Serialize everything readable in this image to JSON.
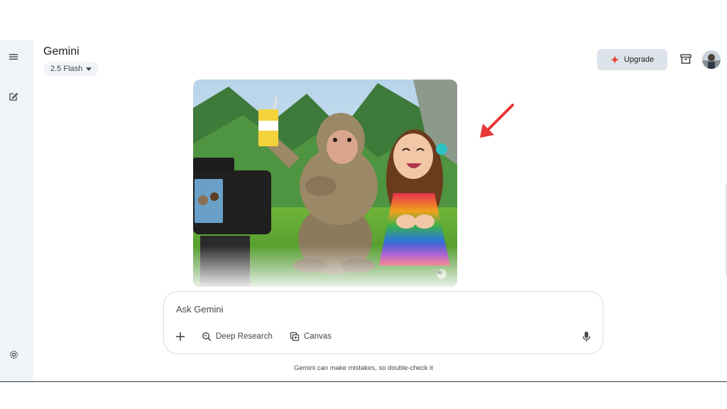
{
  "app": {
    "name": "Gemini",
    "model_label": "2.5 Flash"
  },
  "header": {
    "upgrade_label": "Upgrade"
  },
  "composer": {
    "placeholder": "Ask Gemini",
    "tools": [
      {
        "label": "Deep Research",
        "icon": "deep-research-icon"
      },
      {
        "label": "Canvas",
        "icon": "canvas-icon"
      }
    ]
  },
  "disclaimer": "Gemini can make mistakes, so double-check it",
  "image": {
    "watermark": "AI"
  },
  "colors": {
    "sidebar": "#f0f4f9",
    "upgrade_bg": "#dde3ea",
    "arrow": "#e53935",
    "sparkle": "#e8453c"
  },
  "icons": [
    "menu-icon",
    "new-chat-icon",
    "settings-icon",
    "sparkle-icon",
    "archive-icon",
    "plus-icon",
    "mic-icon",
    "caret-down-icon"
  ]
}
